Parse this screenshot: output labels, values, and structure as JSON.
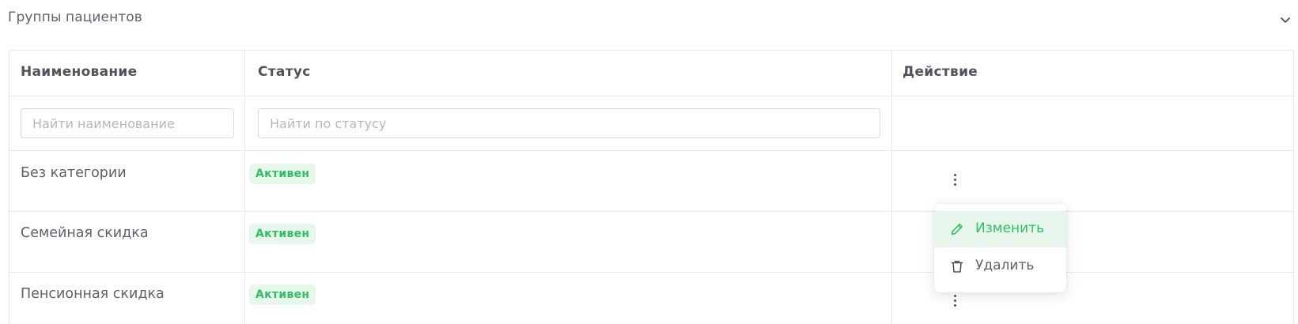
{
  "section": {
    "title": "Группы пациентов",
    "collapse_icon": "chevron-down-icon"
  },
  "table": {
    "columns": [
      "Наименование",
      "Статус",
      "Действие"
    ],
    "filters": {
      "name_placeholder": "Найти наименование",
      "status_placeholder": "Найти по статусу"
    },
    "rows": [
      {
        "name": "Без категории",
        "status": "Активен"
      },
      {
        "name": "Семейная скидка",
        "status": "Активен"
      },
      {
        "name": "Пенсионная скидка",
        "status": "Активен"
      }
    ],
    "status_colors": {
      "active_text": "#2fbf63",
      "active_bg": "#e6f7ec"
    },
    "row_action_icon": "more-vertical-icon"
  },
  "action_menu": {
    "items": [
      {
        "label": "Изменить",
        "icon": "pencil-icon",
        "highlighted": true
      },
      {
        "label": "Удалить",
        "icon": "trash-icon",
        "highlighted": false
      }
    ],
    "accent_color": "#2fbf63"
  }
}
